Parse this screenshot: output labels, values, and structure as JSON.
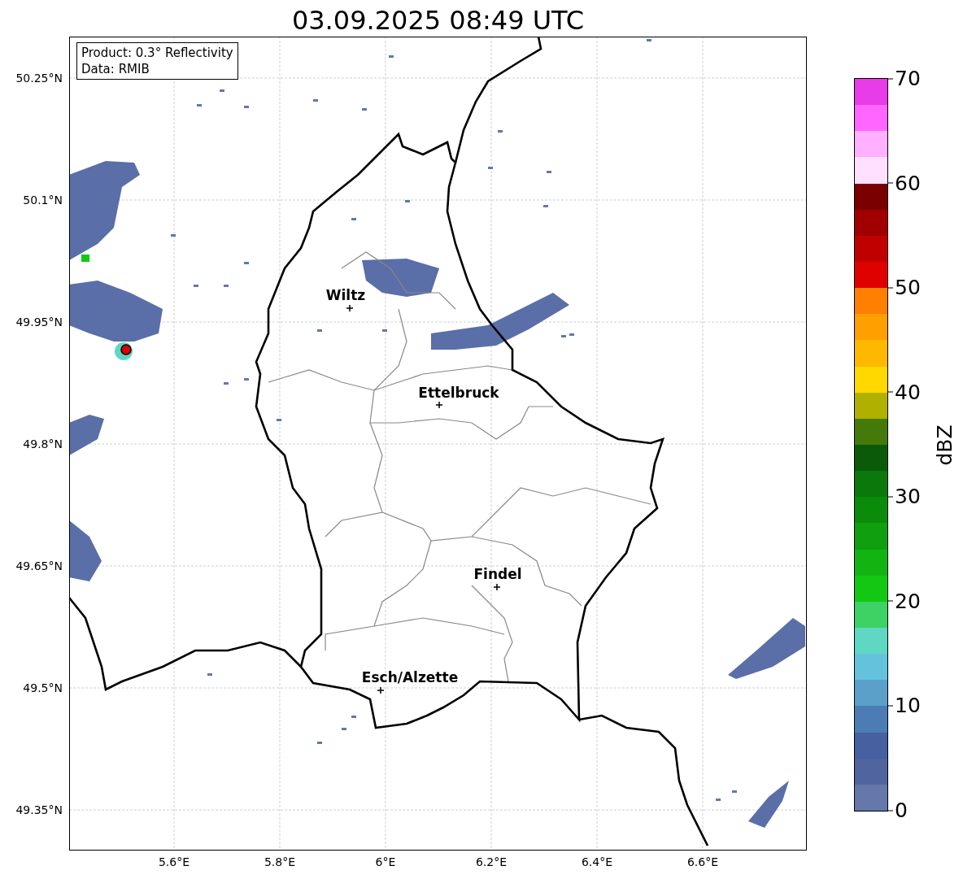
{
  "title": "03.09.2025 08:49 UTC",
  "info_box": {
    "lines": [
      "Product: 0.3° Reflectivity",
      "Data: RMIB"
    ]
  },
  "y_ticks": [
    "50.25°N",
    "50.1°N",
    "49.95°N",
    "49.8°N",
    "49.65°N",
    "49.5°N",
    "49.35°N"
  ],
  "x_ticks": [
    "5.6°E",
    "5.8°E",
    "6°E",
    "6.2°E",
    "6.4°E",
    "6.6°E"
  ],
  "places": [
    {
      "name": "Wiltz"
    },
    {
      "name": "Ettelbruck"
    },
    {
      "name": "Findel"
    },
    {
      "name": "Esch/Alzette"
    }
  ],
  "colorbar": {
    "label": "dBZ",
    "ticks": [
      "70",
      "60",
      "50",
      "40",
      "30",
      "20",
      "10",
      "0"
    ],
    "segments": [
      {
        "color": "#e83ce8"
      },
      {
        "color": "#ff66ff"
      },
      {
        "color": "#ffb0ff"
      },
      {
        "color": "#ffe0ff"
      },
      {
        "color": "#7a0000"
      },
      {
        "color": "#a00000"
      },
      {
        "color": "#c00000"
      },
      {
        "color": "#e00000"
      },
      {
        "color": "#ff7f00"
      },
      {
        "color": "#ff9f00"
      },
      {
        "color": "#ffb800"
      },
      {
        "color": "#ffd800"
      },
      {
        "color": "#b0b000"
      },
      {
        "color": "#457a0a"
      },
      {
        "color": "#0a5a0a"
      },
      {
        "color": "#0a780a"
      },
      {
        "color": "#0a8c0a"
      },
      {
        "color": "#0f9f0f"
      },
      {
        "color": "#12b412"
      },
      {
        "color": "#12c812"
      },
      {
        "color": "#3cd264"
      },
      {
        "color": "#5fd7c3"
      },
      {
        "color": "#64c3dc"
      },
      {
        "color": "#5aa0c8"
      },
      {
        "color": "#4b7db4"
      },
      {
        "color": "#4660a0"
      },
      {
        "color": "#5064a0"
      },
      {
        "color": "#6478aa"
      }
    ]
  }
}
